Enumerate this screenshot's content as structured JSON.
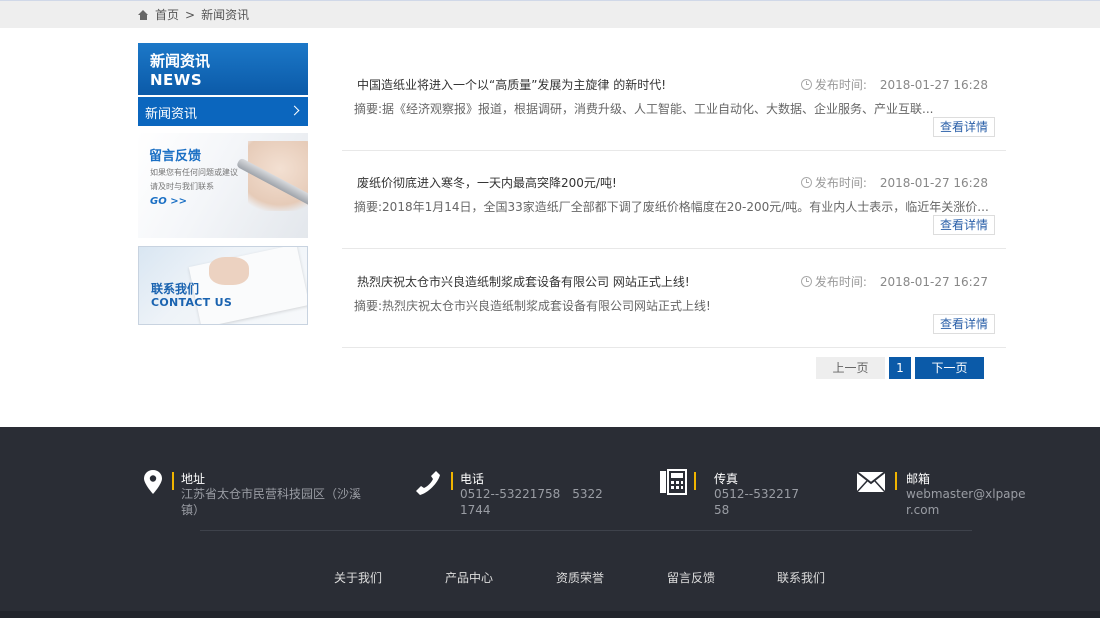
{
  "breadcrumb": {
    "home": "首页",
    "separator": ">",
    "current": "新闻资讯"
  },
  "sidebar": {
    "head_zh": "新闻资讯",
    "head_en": "NEWS",
    "items": [
      {
        "label": "新闻资讯"
      }
    ],
    "promo": {
      "title": "留言反馈",
      "line1": "如果您有任何问题或建议",
      "line2": "请及时与我们联系",
      "go": "GO >>"
    },
    "contact": {
      "zh": "联系我们",
      "en": "CONTACT US"
    }
  },
  "news": {
    "date_label": "发布时间:",
    "summary_label": "摘要:",
    "more_label": "查看详情",
    "items": [
      {
        "title": "中国造纸业将进入一个以“高质量”发展为主旋律 的新时代!",
        "date": "2018-01-27 16:28",
        "summary": "据《经济观察报》报道，根据调研，消费升级、人工智能、工业自动化、大数据、企业服务、产业互联..."
      },
      {
        "title": "废纸价彻底进入寒冬，一天内最高突降200元/吨!",
        "date": "2018-01-27 16:28",
        "summary": "2018年1月14日，全国33家造纸厂全部都下调了废纸价格幅度在20-200元/吨。有业内人士表示，临近年关涨价..."
      },
      {
        "title": "热烈庆祝太仓市兴良造纸制浆成套设备有限公司 网站正式上线!",
        "date": "2018-01-27 16:27",
        "summary": "热烈庆祝太仓市兴良造纸制浆成套设备有限公司网站正式上线!"
      }
    ]
  },
  "pager": {
    "prev": "上一页",
    "current": "1",
    "next": "下一页"
  },
  "footer": {
    "address": {
      "label": "地址",
      "value": "江苏省太仓市民营科技园区（沙溪镇）"
    },
    "phone": {
      "label": "电话",
      "value": "0512--53221758　53221744"
    },
    "fax": {
      "label": "传真",
      "value": "0512--53221758"
    },
    "email": {
      "label": "邮箱",
      "value": "webmaster@xlpaper.com"
    },
    "nav": [
      "关于我们",
      "产品中心",
      "资质荣誉",
      "留言反馈",
      "联系我们"
    ]
  },
  "colors": {
    "brand_blue": "#0b5aa8",
    "footer_bg": "#2a2d35",
    "accent_yellow": "#f0b400"
  }
}
